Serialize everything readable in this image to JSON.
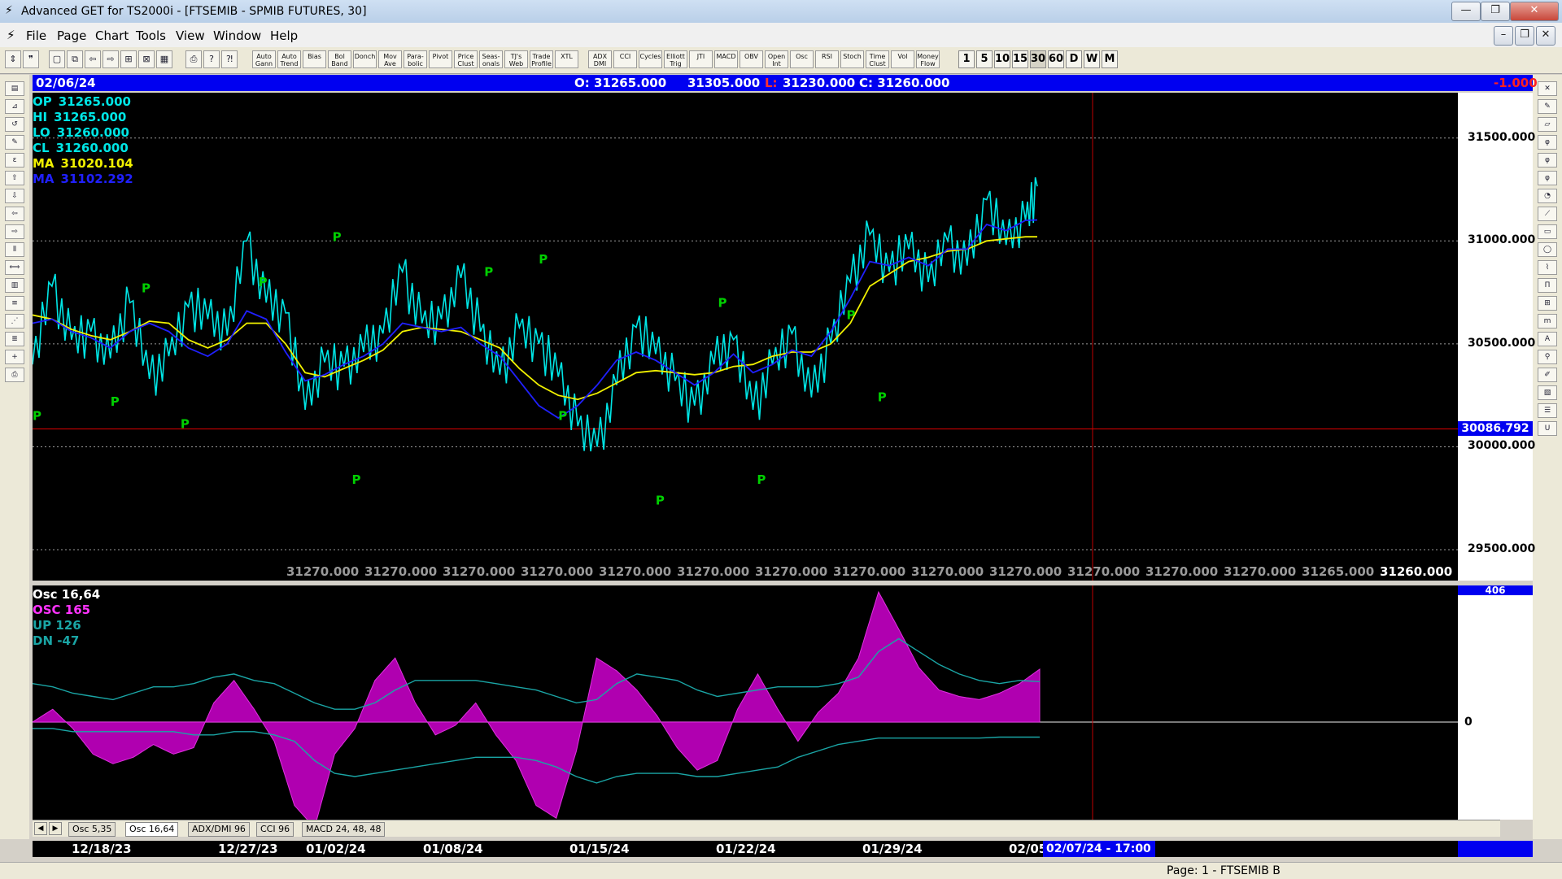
{
  "window": {
    "title": "Advanced GET for TS2000i - [FTSEMIB - SPMIB FUTURES, 30]"
  },
  "menu": [
    "File",
    "Page",
    "Chart",
    "Tools",
    "View",
    "Window",
    "Help"
  ],
  "toolbar": {
    "study_buttons": [
      "Auto Gann",
      "Auto Trend",
      "Bias",
      "Bol Band",
      "Donch",
      "Mov Ave",
      "Para-bolic",
      "Pivot",
      "Price Clust",
      "Seas-onals",
      "TJ's Web",
      "Trade Profile",
      "XTL",
      "ADX DMI",
      "CCI",
      "Cycles",
      "Elliott Trig",
      "JTI",
      "MACD",
      "OBV",
      "Open Int",
      "Osc",
      "RSI",
      "Stoch",
      "Time Clust",
      "Vol",
      "Money Flow"
    ],
    "interval_buttons": [
      "1",
      "5",
      "10",
      "15",
      "30",
      "60",
      "D",
      "W",
      "M"
    ],
    "selected_interval": "30"
  },
  "left_tools": [
    "open",
    "gann",
    "reset",
    "study",
    "elliott",
    "up",
    "down",
    "left",
    "right",
    "pitch",
    "range",
    "bars",
    "lines",
    "gann-fan",
    "fib",
    "cross",
    "print"
  ],
  "right_tools": [
    "close",
    "pencil",
    "eraser",
    "fib-ret",
    "fib-ext",
    "fib-time",
    "cycle",
    "trend",
    "box",
    "ellipse",
    "pattern",
    "pti",
    "grid",
    "mob",
    "text",
    "zoom",
    "paint",
    "stack",
    "list",
    "u-turn"
  ],
  "info_bar": {
    "date": "02/06/24",
    "open": "O: 31265.000",
    "high": "31305.000",
    "low_label": "L:",
    "low": "31230.000",
    "close": "C: 31260.000",
    "change": "-1.000"
  },
  "legend": [
    {
      "label": "OP",
      "value": "31265.000",
      "color": "#00e5e5"
    },
    {
      "label": "HI",
      "value": "31265.000",
      "color": "#00e5e5"
    },
    {
      "label": "LO",
      "value": "31260.000",
      "color": "#00e5e5"
    },
    {
      "label": "CL",
      "value": "31260.000",
      "color": "#00e5e5"
    },
    {
      "label": "MA",
      "value": "31020.104",
      "color": "#f0f000"
    },
    {
      "label": "MA",
      "value": "31102.292",
      "color": "#2020ff"
    }
  ],
  "price_axis": {
    "ticks": [
      "31500.000",
      "31000.000",
      "30500.000",
      "30000.000",
      "29500.000"
    ],
    "current_marker": "30086.792"
  },
  "bottom_values": [
    "31270.000",
    "31270.000",
    "31270.000",
    "31270.000",
    "31270.000",
    "31270.000",
    "31270.000",
    "31270.000",
    "31270.000",
    "31270.000",
    "31270.000",
    "31270.000",
    "31270.000",
    "31265.000",
    "31260.000"
  ],
  "osc_legend": [
    {
      "label": "Osc 16,64",
      "color": "#ffffff"
    },
    {
      "label": "OSC 165",
      "color": "#ff33ff"
    },
    {
      "label": "UP   126",
      "color": "#1aa5a5"
    },
    {
      "label": "DN   -47",
      "color": "#1aa5a5"
    }
  ],
  "osc_axis": {
    "top": "406",
    "zero": "0"
  },
  "tabs": [
    "Osc 5,35",
    "Osc 16,64",
    "ADX/DMI 96",
    "CCI 96",
    "MACD 24, 48, 48"
  ],
  "selected_tab": "Osc 16,64",
  "date_axis": {
    "labels": [
      "12/18/23",
      "12/27/23",
      "01/02/24",
      "01/08/24",
      "01/15/24",
      "01/22/24",
      "01/29/24",
      "02/05"
    ],
    "cursor_label": "02/07/24 - 17:00"
  },
  "status": {
    "page": "Page: 1 - FTSEMIB B"
  },
  "chart_data": {
    "type": "line",
    "title": "FTSEMIB - SPMIB FUTURES, 30",
    "ylim": [
      29350,
      31720
    ],
    "x": [
      0,
      5,
      10,
      15,
      20,
      25,
      30,
      35,
      40,
      45,
      50,
      55,
      60,
      65,
      70,
      75,
      80,
      85,
      90,
      95,
      100,
      105,
      110,
      115,
      120,
      125,
      130,
      135,
      140,
      145,
      150,
      155,
      160,
      165,
      170,
      175,
      180,
      185,
      190,
      195,
      200,
      205,
      210,
      215,
      220,
      225,
      230,
      235,
      240,
      245,
      250,
      255,
      258
    ],
    "series": [
      {
        "name": "FTSEMIB",
        "color": "#00e5e5",
        "values": [
          30400,
          30780,
          30520,
          30560,
          30430,
          30700,
          30330,
          30440,
          30680,
          30620,
          30540,
          31000,
          30700,
          30650,
          30180,
          30410,
          30390,
          30460,
          30550,
          30850,
          30600,
          30620,
          30820,
          30560,
          30350,
          30580,
          30500,
          30340,
          30100,
          30000,
          30300,
          30580,
          30450,
          30320,
          30200,
          30400,
          30520,
          30180,
          30400,
          30550,
          30240,
          30500,
          30800,
          31030,
          30850,
          30960,
          30800,
          31000,
          30880,
          31200,
          30980,
          31100,
          31265
        ]
      },
      {
        "name": "MA",
        "color": "#f0f000",
        "values": [
          30640,
          30620,
          30570,
          30540,
          30520,
          30560,
          30610,
          30600,
          30520,
          30480,
          30520,
          30600,
          30600,
          30500,
          30360,
          30340,
          30380,
          30420,
          30470,
          30560,
          30580,
          30570,
          30560,
          30520,
          30480,
          30380,
          30300,
          30250,
          30230,
          30260,
          30310,
          30360,
          30370,
          30360,
          30350,
          30360,
          30390,
          30400,
          30440,
          30460,
          30460,
          30500,
          30600,
          30780,
          30840,
          30900,
          30920,
          30950,
          30960,
          31000,
          31010,
          31020,
          31020
        ]
      },
      {
        "name": "MA",
        "color": "#2020ff",
        "values": [
          30600,
          30620,
          30560,
          30530,
          30480,
          30560,
          30600,
          30560,
          30480,
          30440,
          30500,
          30660,
          30620,
          30460,
          30320,
          30350,
          30400,
          30440,
          30500,
          30600,
          30580,
          30560,
          30580,
          30500,
          30440,
          30320,
          30200,
          30140,
          30200,
          30300,
          30420,
          30460,
          30420,
          30360,
          30300,
          30360,
          30450,
          30360,
          30400,
          30470,
          30440,
          30560,
          30720,
          30900,
          30880,
          30920,
          30880,
          30960,
          30960,
          31080,
          31050,
          31100,
          31102
        ]
      }
    ],
    "oscillator": {
      "name": "OSC 165",
      "ylim": [
        -400,
        406
      ],
      "values": [
        0,
        40,
        -20,
        -100,
        -130,
        -110,
        -70,
        -100,
        -80,
        60,
        130,
        40,
        -60,
        -260,
        -330,
        -100,
        -20,
        130,
        200,
        60,
        -40,
        -10,
        60,
        -40,
        -120,
        -260,
        -300,
        -90,
        200,
        160,
        100,
        20,
        -80,
        -150,
        -120,
        40,
        150,
        40,
        -60,
        30,
        90,
        200,
        406,
        290,
        170,
        100,
        80,
        70,
        90,
        120,
        165
      ],
      "up": {
        "name": "UP",
        "values": [
          120,
          110,
          90,
          80,
          70,
          90,
          110,
          110,
          120,
          140,
          150,
          130,
          120,
          90,
          60,
          40,
          40,
          60,
          100,
          130,
          130,
          130,
          130,
          120,
          110,
          100,
          80,
          60,
          70,
          120,
          150,
          140,
          130,
          100,
          80,
          90,
          100,
          110,
          110,
          110,
          120,
          140,
          220,
          260,
          220,
          180,
          150,
          130,
          120,
          130,
          126
        ]
      },
      "dn": {
        "name": "DN",
        "values": [
          -20,
          -20,
          -30,
          -30,
          -30,
          -30,
          -30,
          -30,
          -40,
          -40,
          -30,
          -30,
          -40,
          -60,
          -120,
          -160,
          -170,
          -160,
          -150,
          -140,
          -130,
          -120,
          -110,
          -110,
          -110,
          -120,
          -140,
          -170,
          -190,
          -170,
          -160,
          -160,
          -160,
          -170,
          -170,
          -160,
          -150,
          -140,
          -110,
          -90,
          -70,
          -60,
          -50,
          -50,
          -50,
          -50,
          -50,
          -50,
          -47,
          -47,
          -47
        ]
      }
    },
    "markers": [
      {
        "text": "P",
        "color": "#00d000",
        "x": 0,
        "y": 30130
      },
      {
        "text": "P",
        "color": "#00d000",
        "x": 20,
        "y": 30200
      },
      {
        "text": "P",
        "color": "#00d000",
        "x": 28,
        "y": 30750
      },
      {
        "text": "P",
        "color": "#00d000",
        "x": 38,
        "y": 30090
      },
      {
        "text": "P",
        "color": "#00d000",
        "x": 58,
        "y": 30780
      },
      {
        "text": "P",
        "color": "#00d000",
        "x": 77,
        "y": 31000
      },
      {
        "text": "P",
        "color": "#00d000",
        "x": 82,
        "y": 29820
      },
      {
        "text": "P",
        "color": "#00d000",
        "x": 116,
        "y": 30830
      },
      {
        "text": "P",
        "color": "#00d000",
        "x": 130,
        "y": 30890
      },
      {
        "text": "P",
        "color": "#00d000",
        "x": 135,
        "y": 30130
      },
      {
        "text": "P",
        "color": "#00d000",
        "x": 160,
        "y": 29720
      },
      {
        "text": "P",
        "color": "#00d000",
        "x": 176,
        "y": 30680
      },
      {
        "text": "P",
        "color": "#00d000",
        "x": 186,
        "y": 29820
      },
      {
        "text": "P",
        "color": "#00d000",
        "x": 209,
        "y": 30620
      },
      {
        "text": "P",
        "color": "#00d000",
        "x": 217,
        "y": 30220
      }
    ]
  }
}
